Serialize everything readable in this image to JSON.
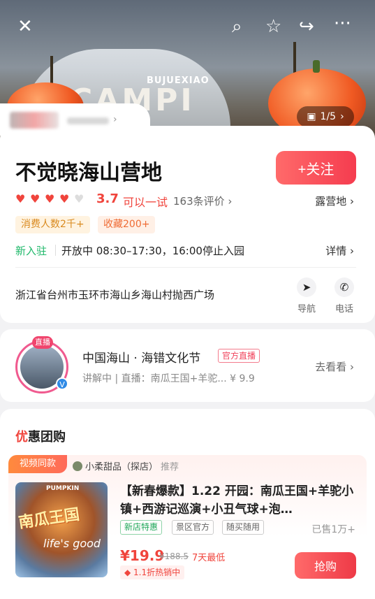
{
  "hero": {
    "sign_text": "CAMPI",
    "sign_top": "BUJUEXIAO",
    "image_counter": "1/5"
  },
  "top_icons": {
    "close": "✕",
    "search": "⌕",
    "favorite": "☆",
    "share": "↪",
    "more": "···"
  },
  "shop": {
    "name": "不觉晓海山营地",
    "follow_label": "+关注",
    "rating": "3.7",
    "rating_text": "可以一试",
    "reviews": "163条评价 ›",
    "category": "露营地 ›",
    "tags": [
      "消费人数2千+",
      "收藏200+"
    ],
    "status_new": "新入驻",
    "hours": "开放中 08:30–17:30，16:00停止入园",
    "detail_link": "详情 ›",
    "address": "浙江省台州市玉环市海山乡海山村抛西广场",
    "nav_label": "导航",
    "phone_label": "电话",
    "hearts_full": 4,
    "hearts_total": 5
  },
  "live": {
    "badge": "直播",
    "title": "中国海山 · 海错文化节",
    "official": "官方直播",
    "subtitle": "讲解中 | 直播：南瓜王国+羊驼...  ¥ 9.9",
    "goto": "去看看 ›"
  },
  "deals": {
    "section_title_first": "优",
    "section_title_rest": "惠团购",
    "video_tag": "视频同款",
    "recommender_name": "小柔甜品（探店）",
    "recommender_suffix": "推荐",
    "thumb_text1": "南瓜王国",
    "thumb_text2": "life's good",
    "thumb_text3": "PUMPKIN",
    "title": "【新春爆款】1.22 开园：南瓜王国+羊驼小镇+西游记巡演+小丑气球+泡…",
    "tags": [
      "新店特惠",
      "景区官方",
      "随买随用"
    ],
    "sold": "已售1万+",
    "price": "¥19.9",
    "old_price": "¥188.5",
    "lowest": "7天最低",
    "hot": "1.1折热销中",
    "buy_label": "抢购"
  }
}
